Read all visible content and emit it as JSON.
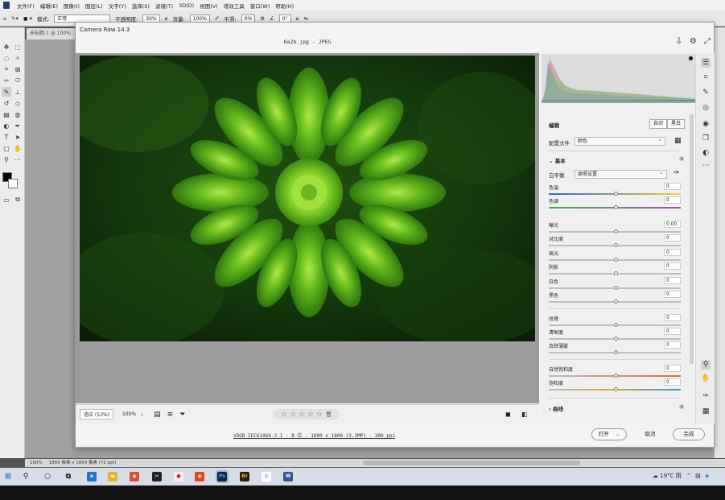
{
  "ps": {
    "menu": [
      "文件(F)",
      "编辑(E)",
      "图像(I)",
      "图层(L)",
      "文字(Y)",
      "选择(S)",
      "滤镜(T)",
      "3D(D)",
      "视图(V)",
      "增效工具",
      "窗口(W)",
      "帮助(H)"
    ],
    "options": {
      "mode_label": "模式:",
      "mode_value": "正常",
      "opacity_label": "不透明度:",
      "opacity_value": "30%",
      "flow_label": "流量:",
      "flow_value": "100%",
      "smoothing_label": "平滑:",
      "smoothing_value": "0%",
      "angle_value": "0°"
    },
    "doc_tab": "未标题-1 @ 100%",
    "status_zoom": "100%",
    "status_size": "1800 像素 x 1800 像素 (72 ppi)"
  },
  "acr": {
    "title": "Camera Raw 14.3",
    "filename": "6a2b.jpg - JPEG",
    "zoom_fit": "适应 (53%)",
    "zoom_100": "100%",
    "stars": "☆ ☆ ☆ ☆ ☆",
    "meta_link": "sRGB IEC61966-2.1 - 8 位 - 1800 x 1800 (3.2MP) - 300 ppi",
    "buttons": {
      "open": "打开",
      "cancel": "取消",
      "done": "完成"
    },
    "panel": {
      "edit_label": "编辑",
      "auto_btn": "自动",
      "bw_btn": "黑白",
      "profile_label": "配置文件",
      "profile_value": "颜色",
      "basic_section": "基本",
      "wb_label": "白平衡",
      "wb_value": "原照设置",
      "sliders": [
        {
          "label": "色温",
          "value": "0"
        },
        {
          "label": "色调",
          "value": "0"
        },
        {
          "label": "曝光",
          "value": "0.00"
        },
        {
          "label": "对比度",
          "value": "0"
        },
        {
          "label": "高光",
          "value": "0"
        },
        {
          "label": "阴影",
          "value": "0"
        },
        {
          "label": "白色",
          "value": "0"
        },
        {
          "label": "黑色",
          "value": "0"
        },
        {
          "label": "纹理",
          "value": "0"
        },
        {
          "label": "清晰度",
          "value": "0"
        },
        {
          "label": "去除薄雾",
          "value": "0"
        },
        {
          "label": "自然饱和度",
          "value": "0"
        },
        {
          "label": "饱和度",
          "value": "0"
        }
      ],
      "curves_section": "曲线"
    }
  },
  "taskbar": {
    "weather": "19°C 阴"
  },
  "colors": {
    "accent": "#2a6ab8",
    "ps_blue": "#1f3f70",
    "plant_green": "#5fae18"
  }
}
